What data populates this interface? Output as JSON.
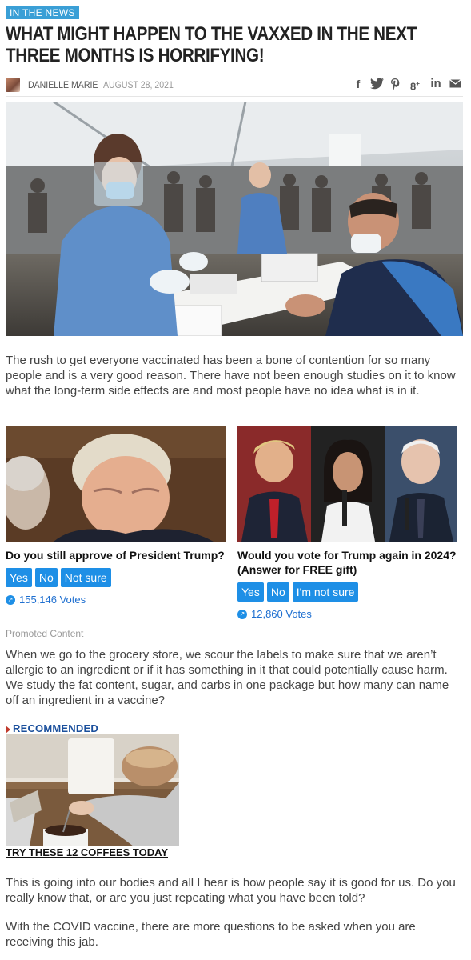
{
  "article": {
    "category": "IN THE NEWS",
    "title": "WHAT MIGHT HAPPEN TO THE VAXXED IN THE NEXT THREE MONTHS IS HORRIFYING!",
    "author": "DANIELLE MARIE",
    "date": "AUGUST 28, 2021",
    "share_icons": [
      "facebook-icon",
      "twitter-icon",
      "pinterest-icon",
      "google-plus-icon",
      "linkedin-icon",
      "email-icon"
    ],
    "paragraphs": [
      "The rush to get everyone vaccinated has been a bone of contention for so many people and is a very good reason. There have not been enough studies on it to know what the long-term side effects are and most people have no idea what is in it.",
      "When we go to the grocery store, we scour the labels to make sure that we aren’t allergic to an ingredient or if it has something in it that could potentially cause harm. We study the fat content, sugar, and carbs in one package but how many can name off an ingredient in a vaccine?",
      "This is going into our bodies and all I hear is how people say it is good for us. Do you really know that, or are you just repeating what you have been told?",
      "With the COVID vaccine, there are more questions to be asked when you are receiving this jab."
    ]
  },
  "polls": [
    {
      "question": "Do you still approve of President Trump?",
      "options": [
        "Yes",
        "No",
        "Not sure"
      ],
      "votes": "155,146 Votes"
    },
    {
      "question": "Would you vote for Trump again in 2024? (Answer for FREE gift)",
      "options": [
        "Yes",
        "No",
        "I'm not sure"
      ],
      "votes": "12,860 Votes"
    }
  ],
  "promoted_label": "Promoted Content",
  "recommended": {
    "label": "RECOMMENDED",
    "caption": "TRY THESE 12 COFFEES TODAY"
  },
  "colors": {
    "accent": "#3a9fd6",
    "button": "#1e8fe6",
    "recommended": "#1a4f9c"
  }
}
